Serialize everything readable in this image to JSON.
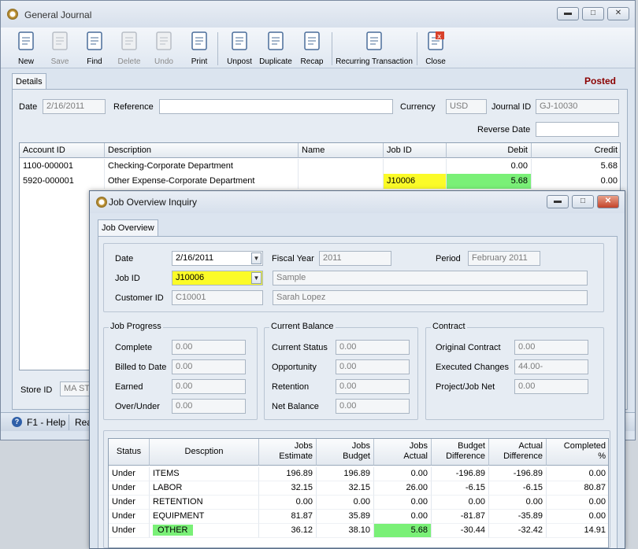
{
  "gj": {
    "title": "General Journal",
    "status": "Posted",
    "toolbar": [
      {
        "name": "new",
        "label": "New",
        "enabled": true,
        "icon": "new-document-icon"
      },
      {
        "name": "save",
        "label": "Save",
        "enabled": false,
        "icon": "floppy-disk-icon"
      },
      {
        "name": "find",
        "label": "Find",
        "enabled": true,
        "icon": "binoculars-icon"
      },
      {
        "name": "delete",
        "label": "Delete",
        "enabled": false,
        "icon": "trash-icon"
      },
      {
        "name": "undo",
        "label": "Undo",
        "enabled": false,
        "icon": "undo-arrow-icon"
      },
      {
        "name": "print",
        "label": "Print",
        "enabled": true,
        "icon": "printer-icon"
      },
      {
        "name": "unpost",
        "label": "Unpost",
        "enabled": true,
        "icon": "unpost-icon"
      },
      {
        "name": "duplicate",
        "label": "Duplicate",
        "enabled": true,
        "icon": "duplicate-icon"
      },
      {
        "name": "recap",
        "label": "Recap",
        "enabled": true,
        "icon": "recap-icon"
      },
      {
        "name": "recurring",
        "label": "Recurring Transaction",
        "enabled": true,
        "icon": "recurring-icon"
      },
      {
        "name": "close",
        "label": "Close",
        "enabled": true,
        "icon": "close-window-icon"
      }
    ],
    "tab": "Details",
    "date_label": "Date",
    "date_value": "2/16/2011",
    "reference_label": "Reference",
    "reference_value": "",
    "currency_label": "Currency",
    "currency_value": "USD",
    "journal_id_label": "Journal ID",
    "journal_id_value": "GJ-10030",
    "reverse_date_label": "Reverse Date",
    "reverse_date_value": "",
    "grid": {
      "headers": [
        "Account ID",
        "Description",
        "Name",
        "Job ID",
        "Debit",
        "Credit"
      ],
      "rows": [
        [
          "1100-000001",
          "Checking-Corporate Department",
          "",
          "",
          "0.00",
          "5.68"
        ],
        [
          "5920-000001",
          "Other Expense-Corporate Department",
          "",
          "J10006",
          "5.68",
          "0.00"
        ]
      ]
    },
    "store_id_label": "Store ID",
    "store_id_value": "MA STO",
    "help_label": "F1 - Help",
    "status_text": "Rea"
  },
  "joi": {
    "title": "Job Overview Inquiry",
    "tab": "Job Overview",
    "date_label": "Date",
    "date_value": "2/16/2011",
    "fiscal_year_label": "Fiscal Year",
    "fiscal_year_value": "2011",
    "period_label": "Period",
    "period_value": "February 2011",
    "job_id_label": "Job ID",
    "job_id_value": "J10006",
    "job_desc_value": "Sample",
    "customer_id_label": "Customer ID",
    "customer_id_value": "C10001",
    "customer_name_value": "Sarah Lopez",
    "job_progress": {
      "title": "Job Progress",
      "fields": [
        {
          "label": "Complete",
          "value": "0.00"
        },
        {
          "label": "Billed to Date",
          "value": "0.00"
        },
        {
          "label": "Earned",
          "value": "0.00"
        },
        {
          "label": "Over/Under",
          "value": "0.00"
        }
      ]
    },
    "current_balance": {
      "title": "Current Balance",
      "fields": [
        {
          "label": "Current Status",
          "value": "0.00"
        },
        {
          "label": "Opportunity",
          "value": "0.00"
        },
        {
          "label": "Retention",
          "value": "0.00"
        },
        {
          "label": "Net Balance",
          "value": "0.00"
        }
      ]
    },
    "contract": {
      "title": "Contract",
      "fields": [
        {
          "label": "Original Contract",
          "value": "0.00"
        },
        {
          "label": "Executed Changes",
          "value": "44.00-"
        },
        {
          "label": "Project/Job Net",
          "value": "0.00"
        }
      ]
    },
    "grid": {
      "headers": [
        [
          "Status"
        ],
        [
          "Descption"
        ],
        [
          "Jobs",
          "Estimate"
        ],
        [
          "Jobs",
          "Budget"
        ],
        [
          "Jobs",
          "Actual"
        ],
        [
          "Budget",
          "Difference"
        ],
        [
          "Actual",
          "Difference"
        ],
        [
          "Completed",
          "%"
        ]
      ],
      "rows": [
        [
          "Under",
          "ITEMS",
          "196.89",
          "196.89",
          "0.00",
          "-196.89",
          "-196.89",
          "0.00"
        ],
        [
          "Under",
          "LABOR",
          "32.15",
          "32.15",
          "26.00",
          "-6.15",
          "-6.15",
          "80.87"
        ],
        [
          "Under",
          "RETENTION",
          "0.00",
          "0.00",
          "0.00",
          "0.00",
          "0.00",
          "0.00"
        ],
        [
          "Under",
          "EQUIPMENT",
          "81.87",
          "35.89",
          "0.00",
          "-81.87",
          "-35.89",
          "0.00"
        ],
        [
          "Under",
          "OTHER",
          "36.12",
          "38.10",
          "5.68",
          "-30.44",
          "-32.42",
          "14.91"
        ]
      ]
    }
  },
  "colors": {
    "posted": "#8b0000",
    "highlight_yellow": "#fbfb28",
    "highlight_green": "#7af077"
  }
}
